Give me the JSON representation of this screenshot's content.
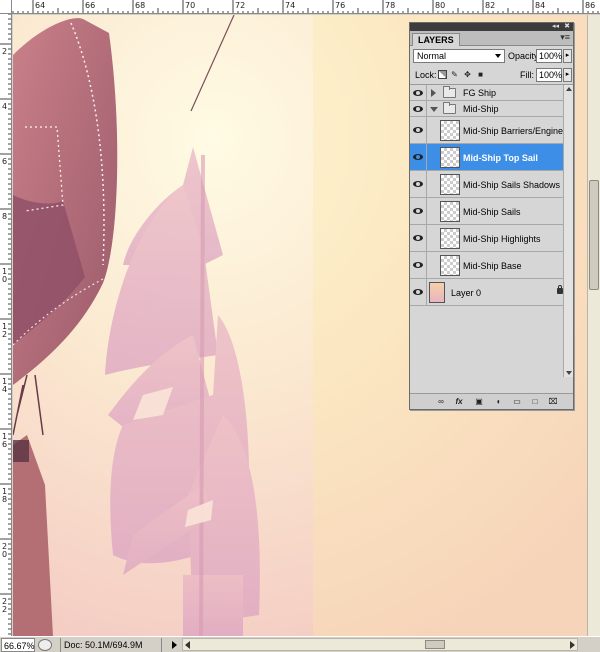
{
  "ruler_top": {
    "labels": [
      {
        "text": "64"
      },
      {
        "text": "66"
      },
      {
        "text": "68"
      },
      {
        "text": "70"
      },
      {
        "text": "72"
      },
      {
        "text": "74"
      },
      {
        "text": "76"
      },
      {
        "text": "78"
      },
      {
        "text": "80"
      },
      {
        "text": "82"
      },
      {
        "text": "84"
      },
      {
        "text": "86"
      }
    ]
  },
  "ruler_left": {
    "labels": [
      "2",
      "4",
      "6",
      "8",
      "10",
      "12",
      "14",
      "16",
      "18",
      "20",
      "22"
    ]
  },
  "status": {
    "zoom": "66.67%",
    "doc": "Doc: 50.1M/694.9M"
  },
  "layers_panel": {
    "tab_label": "LAYERS",
    "collapse_glyph": "◂◂",
    "close_glyph": "✖",
    "menu_glyph": "▾≡",
    "blend_mode": "Normal",
    "opacity_label": "Opacity:",
    "opacity_value": "100%",
    "lock_label": "Lock:",
    "fill_label": "Fill:",
    "fill_value": "100%",
    "arrow_glyph": "▸",
    "groups": {
      "fg_ship": "FG Ship",
      "mid_ship": "Mid-Ship"
    },
    "layers": [
      {
        "name": "Mid-Ship Barriers/Engine",
        "selected": false
      },
      {
        "name": "Mid-Ship Top Sail",
        "selected": true
      },
      {
        "name": "Mid-Ship Sails Shadows",
        "selected": false
      },
      {
        "name": "Mid-Ship Sails",
        "selected": false
      },
      {
        "name": "Mid-Ship Highlights",
        "selected": false
      },
      {
        "name": "Mid-Ship Base",
        "selected": false
      }
    ],
    "background_layer": "Layer 0",
    "selection_color": "#3d8ee6",
    "footer_icons": [
      "link-icon",
      "fx-icon",
      "mask-icon",
      "adjustment-icon",
      "new-group-icon",
      "new-layer-icon",
      "trash-icon"
    ],
    "footer_glyphs": [
      "∞",
      "fx",
      "▣",
      "◐",
      "▭",
      "□",
      "⌧"
    ]
  },
  "colors": {
    "sky_light": "#fdf2d3",
    "sky_pink": "#f4c8c0",
    "sail_dark": "#b16a78",
    "ship_ghost": "#e8b2c6"
  }
}
